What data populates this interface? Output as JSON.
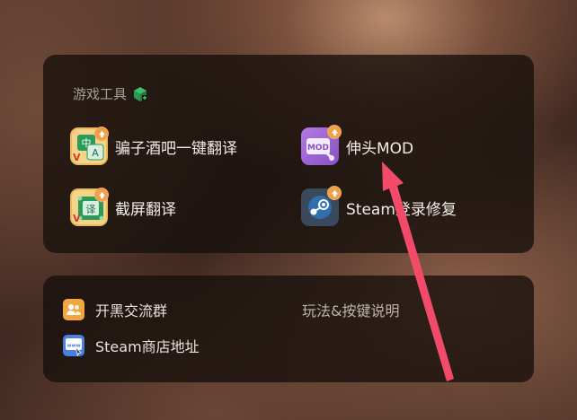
{
  "panel": {
    "title": "游戏工具",
    "tools": [
      {
        "label": "骗子酒吧一键翻译",
        "icon": "zh-en-translate-icon"
      },
      {
        "label": "伸头MOD",
        "icon": "mod-icon"
      },
      {
        "label": "截屏翻译",
        "icon": "screenshot-translate-icon"
      },
      {
        "label": "Steam登录修复",
        "icon": "steam-icon"
      }
    ]
  },
  "links": {
    "items": [
      {
        "label": "开黑交流群",
        "icon": "group-chat-icon"
      },
      {
        "label": "玩法&按键说明",
        "icon": ""
      },
      {
        "label": "Steam商店地址",
        "icon": "www-link-icon"
      }
    ]
  },
  "colors": {
    "card_bg": "#1a110d",
    "upgrade_badge": "#f0a04b",
    "annotation_arrow": "#f24b6a",
    "mod_purple": "#9b5fd0",
    "steam_blue": "#2f6fb0"
  }
}
